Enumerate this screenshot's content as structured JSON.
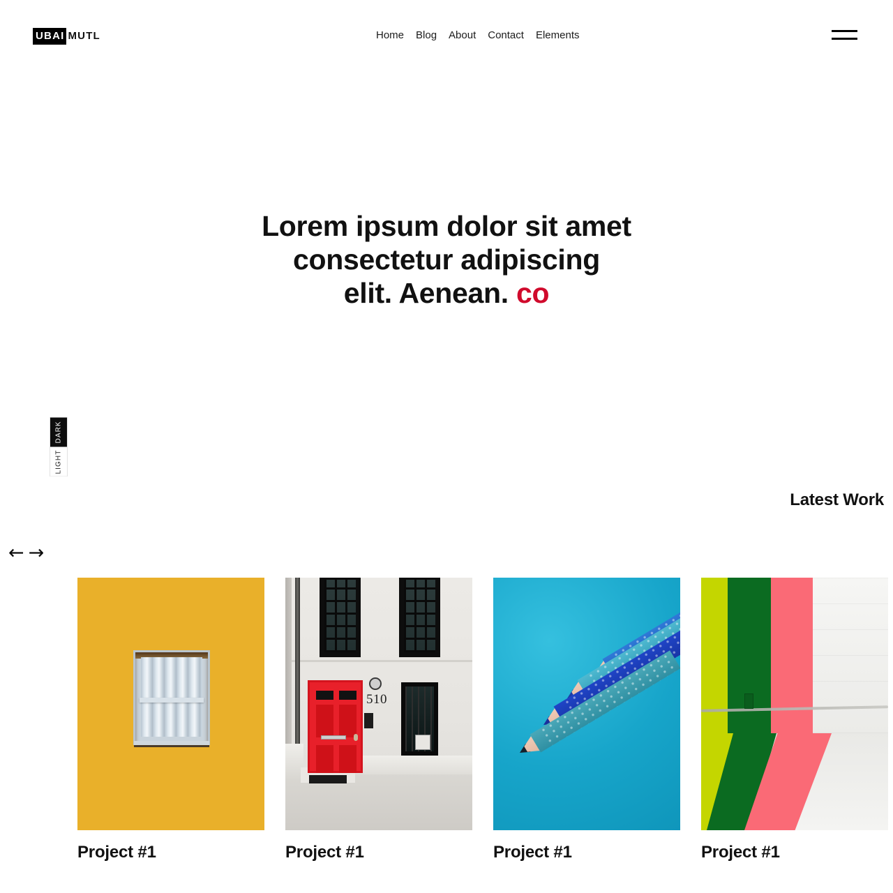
{
  "header": {
    "logo_mark": "UBAI",
    "logo_rest": "MUTL",
    "nav": [
      {
        "label": "Home"
      },
      {
        "label": "Blog"
      },
      {
        "label": "About"
      },
      {
        "label": "Contact"
      },
      {
        "label": "Elements"
      }
    ],
    "menu_icon": "hamburger-icon"
  },
  "hero": {
    "line1": "Lorem ipsum dolor sit amet",
    "line2": "consectetur adipiscing",
    "line3": "elit. Aenean.",
    "typed_text": "co"
  },
  "mode_switch": {
    "dark_label": "DARK",
    "light_label": "LIGHT",
    "selected": "DARK"
  },
  "portfolio": {
    "section_title": "Latest Work",
    "prev_icon": "arrow-left-icon",
    "next_icon": "arrow-right-icon",
    "items": [
      {
        "title": "Project #1",
        "image": "yellow-wall-window"
      },
      {
        "title": "Project #1",
        "image": "white-facade-red-door"
      },
      {
        "title": "Project #1",
        "image": "blue-colored-pencils"
      },
      {
        "title": "Project #1",
        "image": "painted-stripes-wall"
      }
    ]
  },
  "image_details": {
    "door_number": "510"
  },
  "colors": {
    "accent_red": "#D00A2C",
    "text": "#111111",
    "background": "#FFFFFF",
    "logo_block": "#000000"
  }
}
